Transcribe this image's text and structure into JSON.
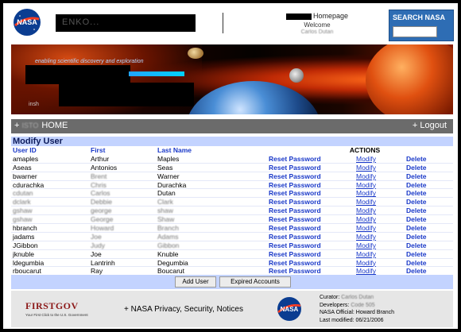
{
  "header": {
    "redacted_title": "ENKO...",
    "homepage_label": "Homepage",
    "welcome_label": "Welcome",
    "user_name": "Carlos Dutan",
    "search_label": "SEARCH NASA",
    "search_placeholder": ""
  },
  "banner": {
    "tagline": "enabling scientific discovery and exploration",
    "subtext": "insh"
  },
  "nav": {
    "home_prefix": "ISTO",
    "home_label": "HOME",
    "logout_label": "+ Logout"
  },
  "section": {
    "title": "Modify User"
  },
  "table": {
    "columns": {
      "user_id": "User ID",
      "first": "First",
      "last_name": "Last Name",
      "actions": "ACTIONS"
    },
    "action_labels": {
      "reset": "Reset Password",
      "modify": "Modify",
      "delete": "Delete"
    },
    "rows": [
      {
        "user_id": "amaples",
        "first": "Arthur",
        "last": "Maples"
      },
      {
        "user_id": "Aseas",
        "first": "Antonios",
        "last": "Seas"
      },
      {
        "user_id": "bwarner",
        "first": "Brent",
        "last": "Warner"
      },
      {
        "user_id": "cdurachka",
        "first": "Chris",
        "last": "Durachka"
      },
      {
        "user_id": "cdutan",
        "first": "Carlos",
        "last": "Dutan"
      },
      {
        "user_id": "dclark",
        "first": "Debbie",
        "last": "Clark"
      },
      {
        "user_id": "gshaw",
        "first": "george",
        "last": "shaw"
      },
      {
        "user_id": "gshaw",
        "first": "George",
        "last": "Shaw"
      },
      {
        "user_id": "hbranch",
        "first": "Howard",
        "last": "Branch"
      },
      {
        "user_id": "jadams",
        "first": "Joe",
        "last": "Adams"
      },
      {
        "user_id": "JGibbon",
        "first": "Judy",
        "last": "Gibbon"
      },
      {
        "user_id": "jknuble",
        "first": "Joe",
        "last": "Knuble"
      },
      {
        "user_id": "ldegumbia",
        "first": "Lantrinh",
        "last": "Degumbia"
      },
      {
        "user_id": "rboucarut",
        "first": "Ray",
        "last": "Boucarut"
      }
    ]
  },
  "buttons": {
    "add_user": "Add User",
    "expired_accounts": "Expired Accounts"
  },
  "footer": {
    "firstgov": "FIRSTGOV",
    "firstgov_sub": "Your First Click to the U.S. Government",
    "links": "+ NASA Privacy, Security, Notices",
    "curator_label": "Curator:",
    "curator_name": "Carlos Dutan",
    "developers_label": "Developers:",
    "developers_name": "Code 505",
    "official_label": "NASA Official: Howard Branch",
    "modified_label": "Last modified: 06/21/2006"
  },
  "colors": {
    "accent_blue": "#1a39c9",
    "header_band": "#c3d3ff",
    "nav_gray": "#6b6b6b",
    "search_blue": "#2e6db4"
  }
}
